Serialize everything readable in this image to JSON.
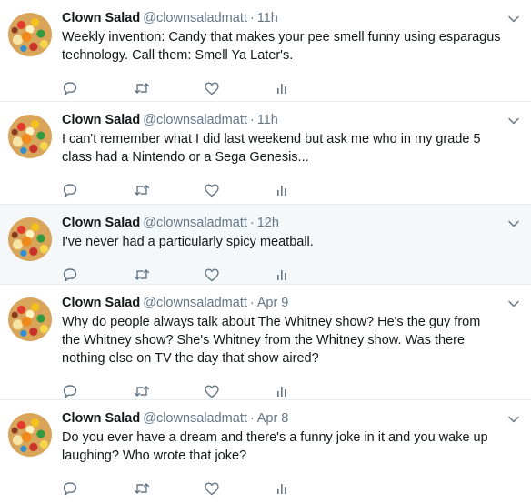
{
  "tweets": [
    {
      "name": "Clown Salad",
      "handle": "@clownsaladmatt",
      "separator": "·",
      "time": "11h",
      "text": "Weekly invention: Candy that makes your pee smell funny using esparagus technology. Call them: Smell Ya Later's."
    },
    {
      "name": "Clown Salad",
      "handle": "@clownsaladmatt",
      "separator": "·",
      "time": "11h",
      "text": "I can't remember what I did last weekend but ask me who in my grade 5 class had a Nintendo or a Sega Genesis..."
    },
    {
      "name": "Clown Salad",
      "handle": "@clownsaladmatt",
      "separator": "·",
      "time": "12h",
      "text": "I've never had a particularly spicy meatball."
    },
    {
      "name": "Clown Salad",
      "handle": "@clownsaladmatt",
      "separator": "·",
      "time": "Apr 9",
      "text": "Why do people always talk about The Whitney show? He's the guy from the Whitney show? She's Whitney from the Whitney show. Was there nothing else on TV the day that show aired?"
    },
    {
      "name": "Clown Salad",
      "handle": "@clownsaladmatt",
      "separator": "·",
      "time": "Apr 8",
      "text": "Do you ever have a dream and there's a funny joke in it and you wake up laughing? Who wrote that joke?"
    }
  ],
  "icons": {
    "reply": "reply-icon",
    "retweet": "retweet-icon",
    "like": "heart-icon",
    "analytics": "analytics-icon",
    "caret": "chevron-down-icon"
  },
  "colors": {
    "name": "#14171a",
    "meta": "#657786",
    "icon": "#657786",
    "highlight_background": "#f5f8fa",
    "divider": "#e6ecf0"
  }
}
